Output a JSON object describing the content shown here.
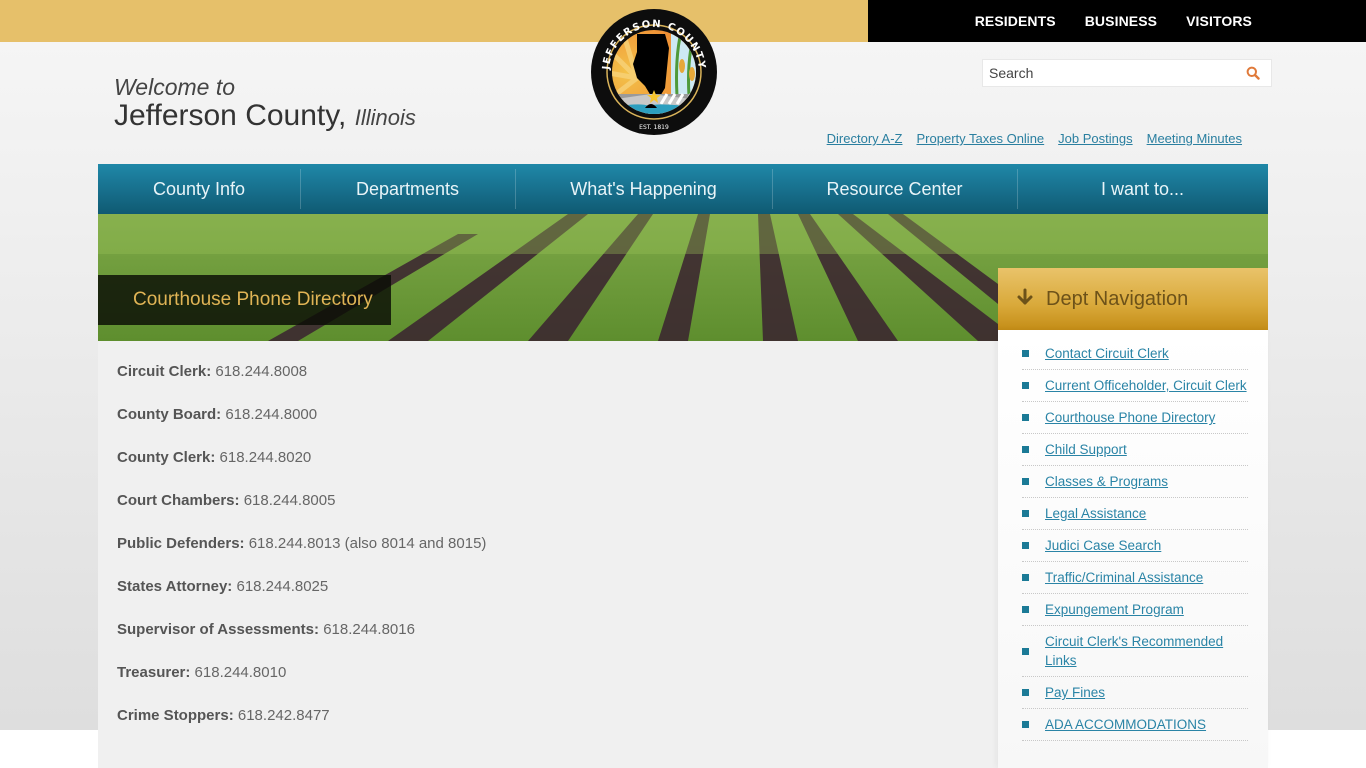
{
  "header": {
    "top_nav": [
      "RESIDENTS",
      "BUSINESS",
      "VISITORS"
    ],
    "welcome_line": "Welcome to",
    "county_name": "Jefferson County,",
    "state_name": "Illinois",
    "logo": {
      "ring_text": "JEFFERSON COUNTY",
      "est_text": "EST. 1819"
    },
    "search": {
      "placeholder": "Search",
      "value": ""
    },
    "quick_links": [
      "Directory A-Z",
      "Property Taxes Online",
      "Job Postings",
      "Meeting Minutes"
    ]
  },
  "main_nav": [
    "County Info",
    "Departments",
    "What's Happening",
    "Resource Center",
    "I want to..."
  ],
  "page_title": "Courthouse Phone Directory",
  "directory": [
    {
      "label": "Circuit Clerk:",
      "phone": "618.244.8008"
    },
    {
      "label": "County Board:",
      "phone": "618.244.8000"
    },
    {
      "label": "County Clerk:",
      "phone": "618.244.8020"
    },
    {
      "label": "Court Chambers:",
      "phone": "618.244.8005"
    },
    {
      "label": "Public Defenders:",
      "phone": "618.244.8013 (also 8014 and 8015)"
    },
    {
      "label": "States Attorney:",
      "phone": "618.244.8025"
    },
    {
      "label": "Supervisor of Assessments:",
      "phone": "618.244.8016"
    },
    {
      "label": "Treasurer:",
      "phone": "618.244.8010"
    },
    {
      "label": "Crime Stoppers:",
      "phone": "618.242.8477"
    }
  ],
  "sidebar": {
    "title": "Dept Navigation",
    "items": [
      "Contact Circuit Clerk",
      "Current Officeholder, Circuit Clerk",
      "Courthouse Phone Directory",
      "Child Support",
      "Classes & Programs",
      "Legal Assistance",
      "Judici Case Search",
      "Traffic/Criminal Assistance",
      "Expungement Program",
      "Circuit Clerk's Recommended Links",
      "Pay Fines",
      "ADA ACCOMMODATIONS"
    ]
  },
  "colors": {
    "gold": "#e6c06a",
    "nav_teal": "#176e8b",
    "link": "#2a84a6",
    "title_gold": "#e0b455",
    "search_icon": "#e07a3a"
  }
}
